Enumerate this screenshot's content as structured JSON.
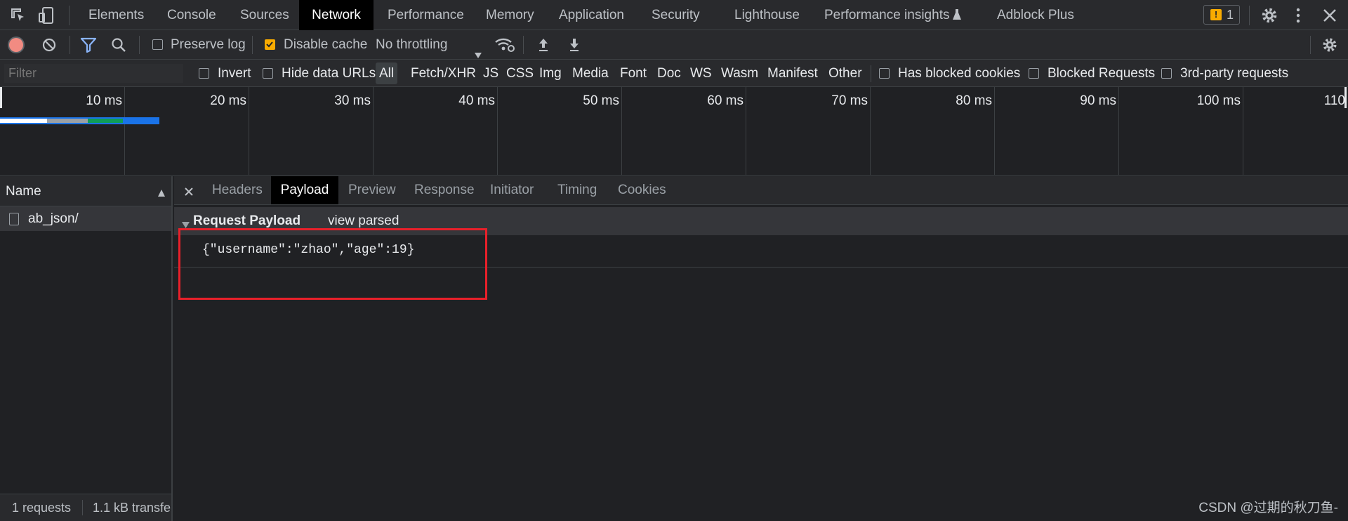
{
  "devtools": {
    "tabs": [
      "Elements",
      "Console",
      "Sources",
      "Network",
      "Performance",
      "Memory",
      "Application",
      "Security",
      "Lighthouse",
      "Performance insights",
      "Adblock Plus"
    ],
    "active_tab": "Network",
    "issues_count": "1"
  },
  "toolbar": {
    "preserve_log_label": "Preserve log",
    "disable_cache_label": "Disable cache",
    "throttling_value": "No throttling"
  },
  "filter": {
    "placeholder": "Filter",
    "invert_label": "Invert",
    "hide_data_urls_label": "Hide data URLs",
    "types": [
      "All",
      "Fetch/XHR",
      "JS",
      "CSS",
      "Img",
      "Media",
      "Font",
      "Doc",
      "WS",
      "Wasm",
      "Manifest",
      "Other"
    ],
    "has_blocked_cookies_label": "Has blocked cookies",
    "blocked_requests_label": "Blocked Requests",
    "third_party_label": "3rd-party requests"
  },
  "timeline": {
    "ticks": [
      "10 ms",
      "20 ms",
      "30 ms",
      "40 ms",
      "50 ms",
      "60 ms",
      "70 ms",
      "80 ms",
      "90 ms",
      "100 ms",
      "110"
    ],
    "colors": {
      "white": "#ffffff",
      "gray": "#9aa0a6",
      "green": "#0f9d58",
      "blue": "#1a73e8"
    }
  },
  "requests": {
    "column_name": "Name",
    "rows": [
      "ab_json/"
    ],
    "summary_count": "1 requests",
    "summary_transfer": "1.1 kB transfe"
  },
  "detail": {
    "tabs": [
      "Headers",
      "Payload",
      "Preview",
      "Response",
      "Initiator",
      "Timing",
      "Cookies"
    ],
    "active_tab": "Payload",
    "section_title": "Request Payload",
    "view_parsed": "view parsed",
    "payload": "{\"username\":\"zhao\",\"age\":19}"
  },
  "watermark": "CSDN @过期的秋刀鱼-",
  "highlight_color": "#e8202a"
}
